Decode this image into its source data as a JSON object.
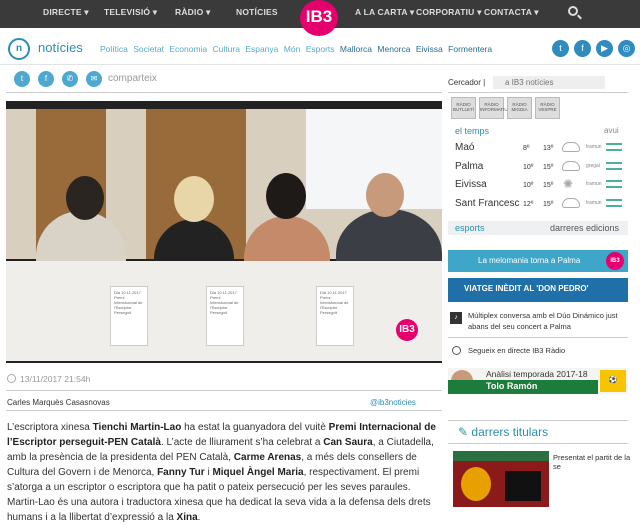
{
  "topnav": {
    "left": [
      "DIRECTE ▾",
      "TELEVISIÓ ▾",
      "RÀDIO ▾",
      "NOTÍCIES"
    ],
    "right": [
      "A LA CARTA ▾",
      "CORPORATIU ▾",
      "CONTACTA ▾"
    ],
    "logo": "IB3"
  },
  "section": {
    "logo": "n",
    "title": "notícies",
    "categories": [
      "Política",
      "Societat",
      "Economia",
      "Cultura",
      "Espanya",
      "Món",
      "Esports",
      "Mallorca",
      "Menorca",
      "Eivissa",
      "Formentera"
    ]
  },
  "social_icons": [
    "twitter-icon",
    "facebook-icon",
    "youtube-icon",
    "instagram-icon"
  ],
  "share": {
    "label": "comparteix",
    "icons": [
      "twitter-icon",
      "facebook-icon",
      "whatsapp-icon",
      "mail-icon"
    ]
  },
  "video": {
    "logo": "IB3",
    "cards": [
      "Dia 10.11.2017 Premi Internacional de l'Escriptor Perseguit",
      "Dia 10.11.2017 Premi Internacional de l'Escriptor Perseguit",
      "Dia 10.11.2017 Premi Internacional de l'Escriptor Perseguit"
    ]
  },
  "meta": {
    "date": "13/11/2017 21:54h",
    "author": "Carles Marquès Casasnovas",
    "handle": "@ib3noticies"
  },
  "article": {
    "t1": "L’escriptora xinesa ",
    "b1": "Tienchi Martin-Lao",
    "t2": " ha estat la guanyadora del vuitè ",
    "b2": "Premi Internacional de l’Escriptor perseguit-PEN Català",
    "t3": ". L’acte de lliurament s’ha celebrat a ",
    "b3": "Can Saura",
    "t4": ", a Ciutadella, amb la presència de la presidenta del PEN Català, ",
    "b4": "Carme Arenas",
    "t5": ", a més dels consellers de Cultura del Govern i de Menorca, ",
    "b5": "Fanny Tur",
    "t6": " i ",
    "b6": "Miquel Àngel Maria",
    "t7": ", respectivament. El premi s’atorga a un escriptor o escriptora que ha patit o pateix persecució per les seves paraules. Martin-Lao és una autora i traductora xinesa que ha dedicat la seva vida a la defensa dels drets humans i a la llibertat d’expressió a la ",
    "b7": "Xina",
    "t8": "."
  },
  "sidebar": {
    "search_label": "Cercador |",
    "search_placeholder": "a IB3 notícies",
    "radio_buttons": [
      "RÀDIO BUTLLETÍ",
      "RÀDIO INFORMATIU",
      "RÀDIO MIGDIA",
      "RÀDIO VESPRE"
    ],
    "weather": {
      "title": "el temps",
      "day": "avui",
      "rows": [
        {
          "city": "Maó",
          "lo": "8º",
          "hi": "13º",
          "cond": "tramun",
          "icon": "cloud-icon"
        },
        {
          "city": "Palma",
          "lo": "10º",
          "hi": "15º",
          "cond": "gregal",
          "icon": "cloud-icon"
        },
        {
          "city": "Eivissa",
          "lo": "10º",
          "hi": "15º",
          "cond": "tramun",
          "icon": "sun-icon"
        },
        {
          "city": "Sant Francesc",
          "lo": "12º",
          "hi": "15º",
          "cond": "tramun",
          "icon": "cloud-icon"
        }
      ]
    },
    "tabs": {
      "left": "esports",
      "right": "darreres edicions"
    },
    "banners": [
      {
        "text": "La melomania torna a Palma",
        "color": "#3ea6c8"
      },
      {
        "text": "VIATGE INÈDIT AL 'DON PEDRO'",
        "color": "#1f6fa8"
      }
    ],
    "radio_promo": {
      "title": "Múltiplex conversa amb el Dúo Dinámico just abans del seu concert a Palma",
      "live": "Segueix en directe IB3 Ràdio"
    },
    "analysis": {
      "line1": "Anàlisi temporada 2017-18",
      "line2": "Tolo Ramón"
    },
    "darrers_title": "darrers titulars",
    "present": "Presentat el partit de la se"
  }
}
